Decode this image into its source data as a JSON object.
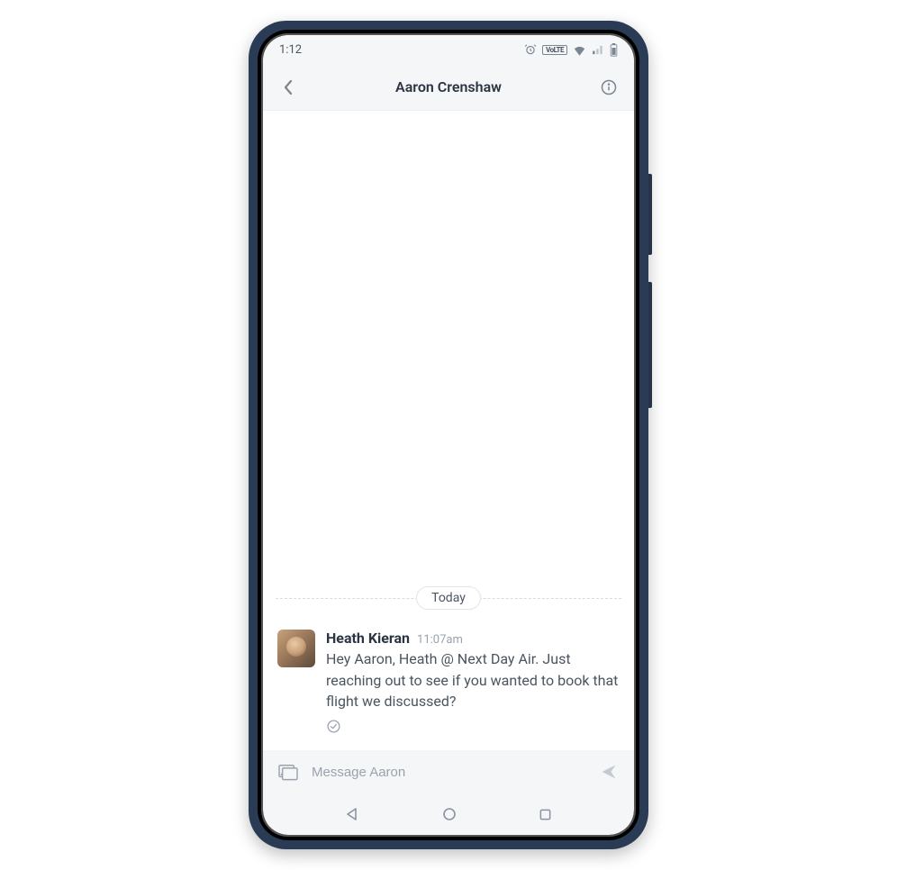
{
  "statusbar": {
    "time": "1:12",
    "volte_label": "VoLTE"
  },
  "header": {
    "title": "Aaron Crenshaw"
  },
  "chat": {
    "date_label": "Today",
    "messages": [
      {
        "sender": "Heath Kieran",
        "time": "11:07am",
        "text": "Hey Aaron, Heath @ Next Day Air. Just reaching out to see if you wanted to book that flight we discussed?"
      }
    ]
  },
  "composer": {
    "placeholder": "Message Aaron"
  }
}
